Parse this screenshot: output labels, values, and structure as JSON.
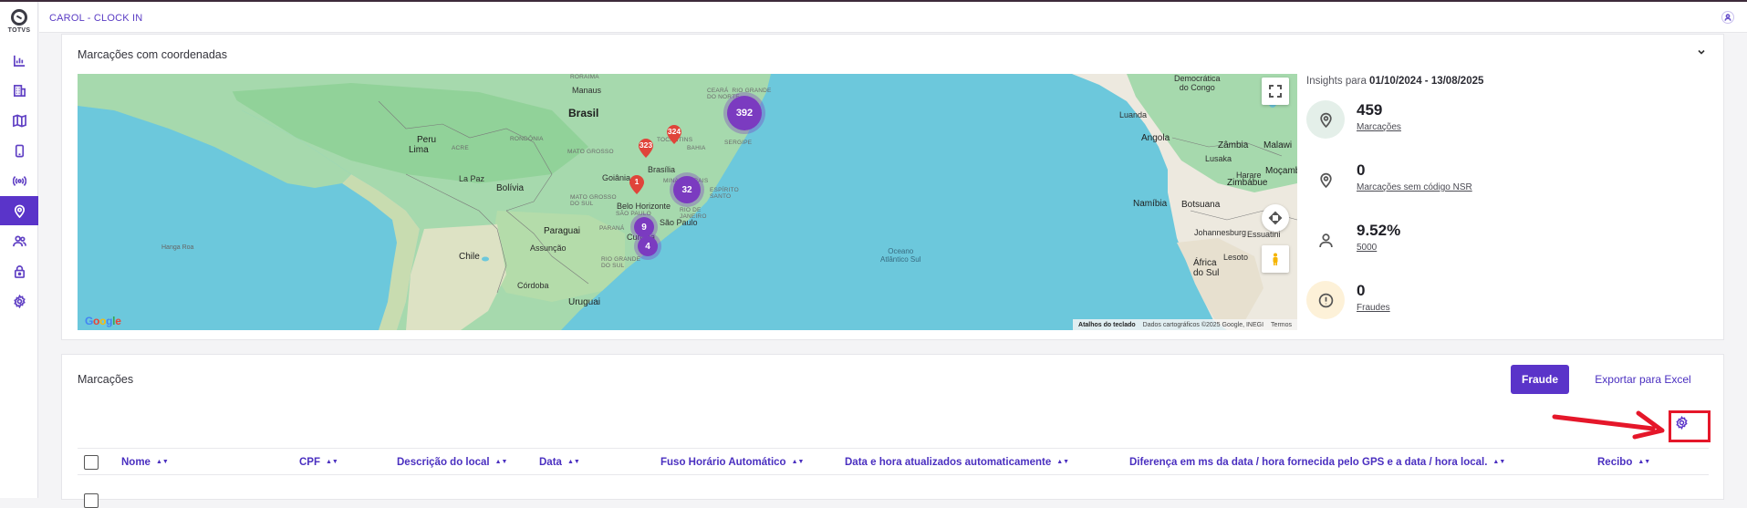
{
  "sidebar": {
    "logo_text": "TOTVS",
    "items": [
      {
        "icon": "chart-icon"
      },
      {
        "icon": "building-icon"
      },
      {
        "icon": "map-icon"
      },
      {
        "icon": "phone-icon"
      },
      {
        "icon": "signal-icon"
      },
      {
        "icon": "location-pin-icon",
        "active": true
      },
      {
        "icon": "users-icon"
      },
      {
        "icon": "lock-icon"
      },
      {
        "icon": "gear-icon"
      }
    ]
  },
  "header": {
    "title": "CAROL - CLOCK IN"
  },
  "map_card": {
    "title": "Marcações com coordenadas",
    "map": {
      "labels": {
        "brasil": "Brasil",
        "peru": "Peru",
        "bolivia": "Bolívia",
        "paraguai": "Paraguai",
        "chile": "Chile",
        "uruguai": "Uruguai",
        "lima": "Lima",
        "la_paz": "La Paz",
        "manaus": "Manaus",
        "brasilia": "Brasília",
        "goiania": "Goiânia",
        "belo_horizonte": "Belo Horizonte",
        "sao_paulo": "São Paulo",
        "curitiba": "Curitiba",
        "assuncao": "Assunção",
        "cordoba": "Córdoba",
        "hanga_roa": "Hanga Roa",
        "oceano": "Oceano\nAtlântico Sul",
        "rep_congo": "Democrática\ndo Congo",
        "luanda": "Luanda",
        "angola": "Angola",
        "zambia": "Zâmbia",
        "malawi": "Malawi",
        "namibia": "Namíbia",
        "botsuana": "Botsuana",
        "zimbabue": "Zimbábue",
        "lusaka": "Lusaka",
        "harare": "Harare",
        "mocambique": "Moçamb",
        "johannesburg": "Johannesburg",
        "essuatini": "Essuatini",
        "lesoto": "Lesoto",
        "africa_sul": "África\ndo Sul",
        "tocantins": "TOCANTINS",
        "bahia": "BAHIA",
        "mato_grosso": "MATO GROSSO",
        "minas_gerais": "MINAS GERAIS",
        "rondonia": "RONDÔNIA",
        "sergipe": "SERGIPE",
        "ceara": "CEARÁ  RIO GRANDE\nDO NORTE",
        "roraima": "RORAIMA",
        "espirito_santo": "ESPÍRITO\nSANTO",
        "rio_de_janeiro": "RIO DE\nJANEIRO",
        "sao_paulo_state": "SÃO PAULO",
        "parana": "PARANÁ",
        "rio_grande_do_sul": "RIO GRANDE\nDO SUL",
        "mato_grosso_sul": "MATO GROSSO\nDO SUL",
        "acre": "ACRE"
      },
      "clusters": [
        {
          "value": "392"
        },
        {
          "value": "32"
        },
        {
          "value": "9"
        },
        {
          "value": "4"
        }
      ],
      "pins": [
        {
          "value": "324"
        },
        {
          "value": "323"
        },
        {
          "value": "1"
        }
      ],
      "google": "Google",
      "footer": {
        "shortcuts": "Atalhos do teclado",
        "data": "Dados cartográficos ©2025 Google, INEGI",
        "terms": "Termos"
      }
    },
    "insights": {
      "prefix": "Insights para ",
      "period": "01/10/2024 - 13/08/2025",
      "items": [
        {
          "value": "459",
          "label": "Marcações",
          "icon": "location-pin-icon",
          "bg": "#e4efe9"
        },
        {
          "value": "0",
          "label": "Marcações sem código NSR",
          "icon": "location-pin-icon",
          "bg": "#ffffff"
        },
        {
          "value": "9.52%",
          "label": "5000",
          "icon": "user-icon",
          "bg": "#ffffff"
        },
        {
          "value": "0",
          "label": "Fraudes",
          "icon": "alert-icon",
          "bg": "#fdf1d8"
        }
      ]
    }
  },
  "marcacoes_card": {
    "title": "Marcações",
    "fraude_button": "Fraude",
    "export_button": "Exportar para Excel",
    "columns": [
      "Nome",
      "CPF",
      "Descrição do local",
      "Data",
      "Fuso Horário Automático",
      "Data e hora atualizados automaticamente",
      "Diferença em ms da data / hora fornecida pelo GPS e a data / hora local.",
      "Recibo"
    ]
  },
  "colors": {
    "accent": "#5a34c9",
    "annotation": "#e5172a"
  }
}
